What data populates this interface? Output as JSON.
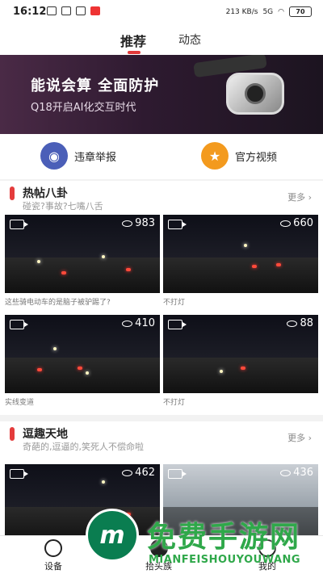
{
  "status": {
    "time": "16:12",
    "signal_text": "213 KB/s",
    "network": "5G",
    "battery": "70"
  },
  "tabs": [
    {
      "label": "推荐"
    },
    {
      "label": "动态"
    }
  ],
  "banner": {
    "headline": "能说会算 全面防护",
    "subline": "Q18开启AI化交互时代"
  },
  "quick_actions": [
    {
      "label": "违章举报",
      "icon": "shield-badge-icon",
      "color": "#4b5fb8"
    },
    {
      "label": "官方视频",
      "icon": "star-badge-icon",
      "color": "#f39a1e"
    }
  ],
  "section_hot": {
    "title": "热帖八卦",
    "subtitle": "碰瓷?事故?七嘴八舌",
    "more": "更多",
    "cards": [
      {
        "views": "983",
        "caption": "这些骑电动车的是脑子被驴踢了?"
      },
      {
        "views": "660",
        "caption": "不打灯"
      },
      {
        "views": "410",
        "caption": "实线变道"
      },
      {
        "views": "88",
        "caption": "不打灯"
      }
    ]
  },
  "section_fun": {
    "title": "逗趣天地",
    "subtitle": "奇葩的,逗逼的,笑死人不偿命啦",
    "more": "更多",
    "cards": [
      {
        "views": "462"
      },
      {
        "views": "436"
      }
    ]
  },
  "bottom_nav": [
    {
      "label": "设备"
    },
    {
      "label": "拾头族"
    },
    {
      "label": "我的"
    }
  ],
  "watermark": {
    "cn": "免费手游网",
    "en": "MIANFEISHOUYOUWANG"
  },
  "colors": {
    "accent": "#e23a3a",
    "report": "#4b5fb8",
    "video": "#f39a1e"
  }
}
